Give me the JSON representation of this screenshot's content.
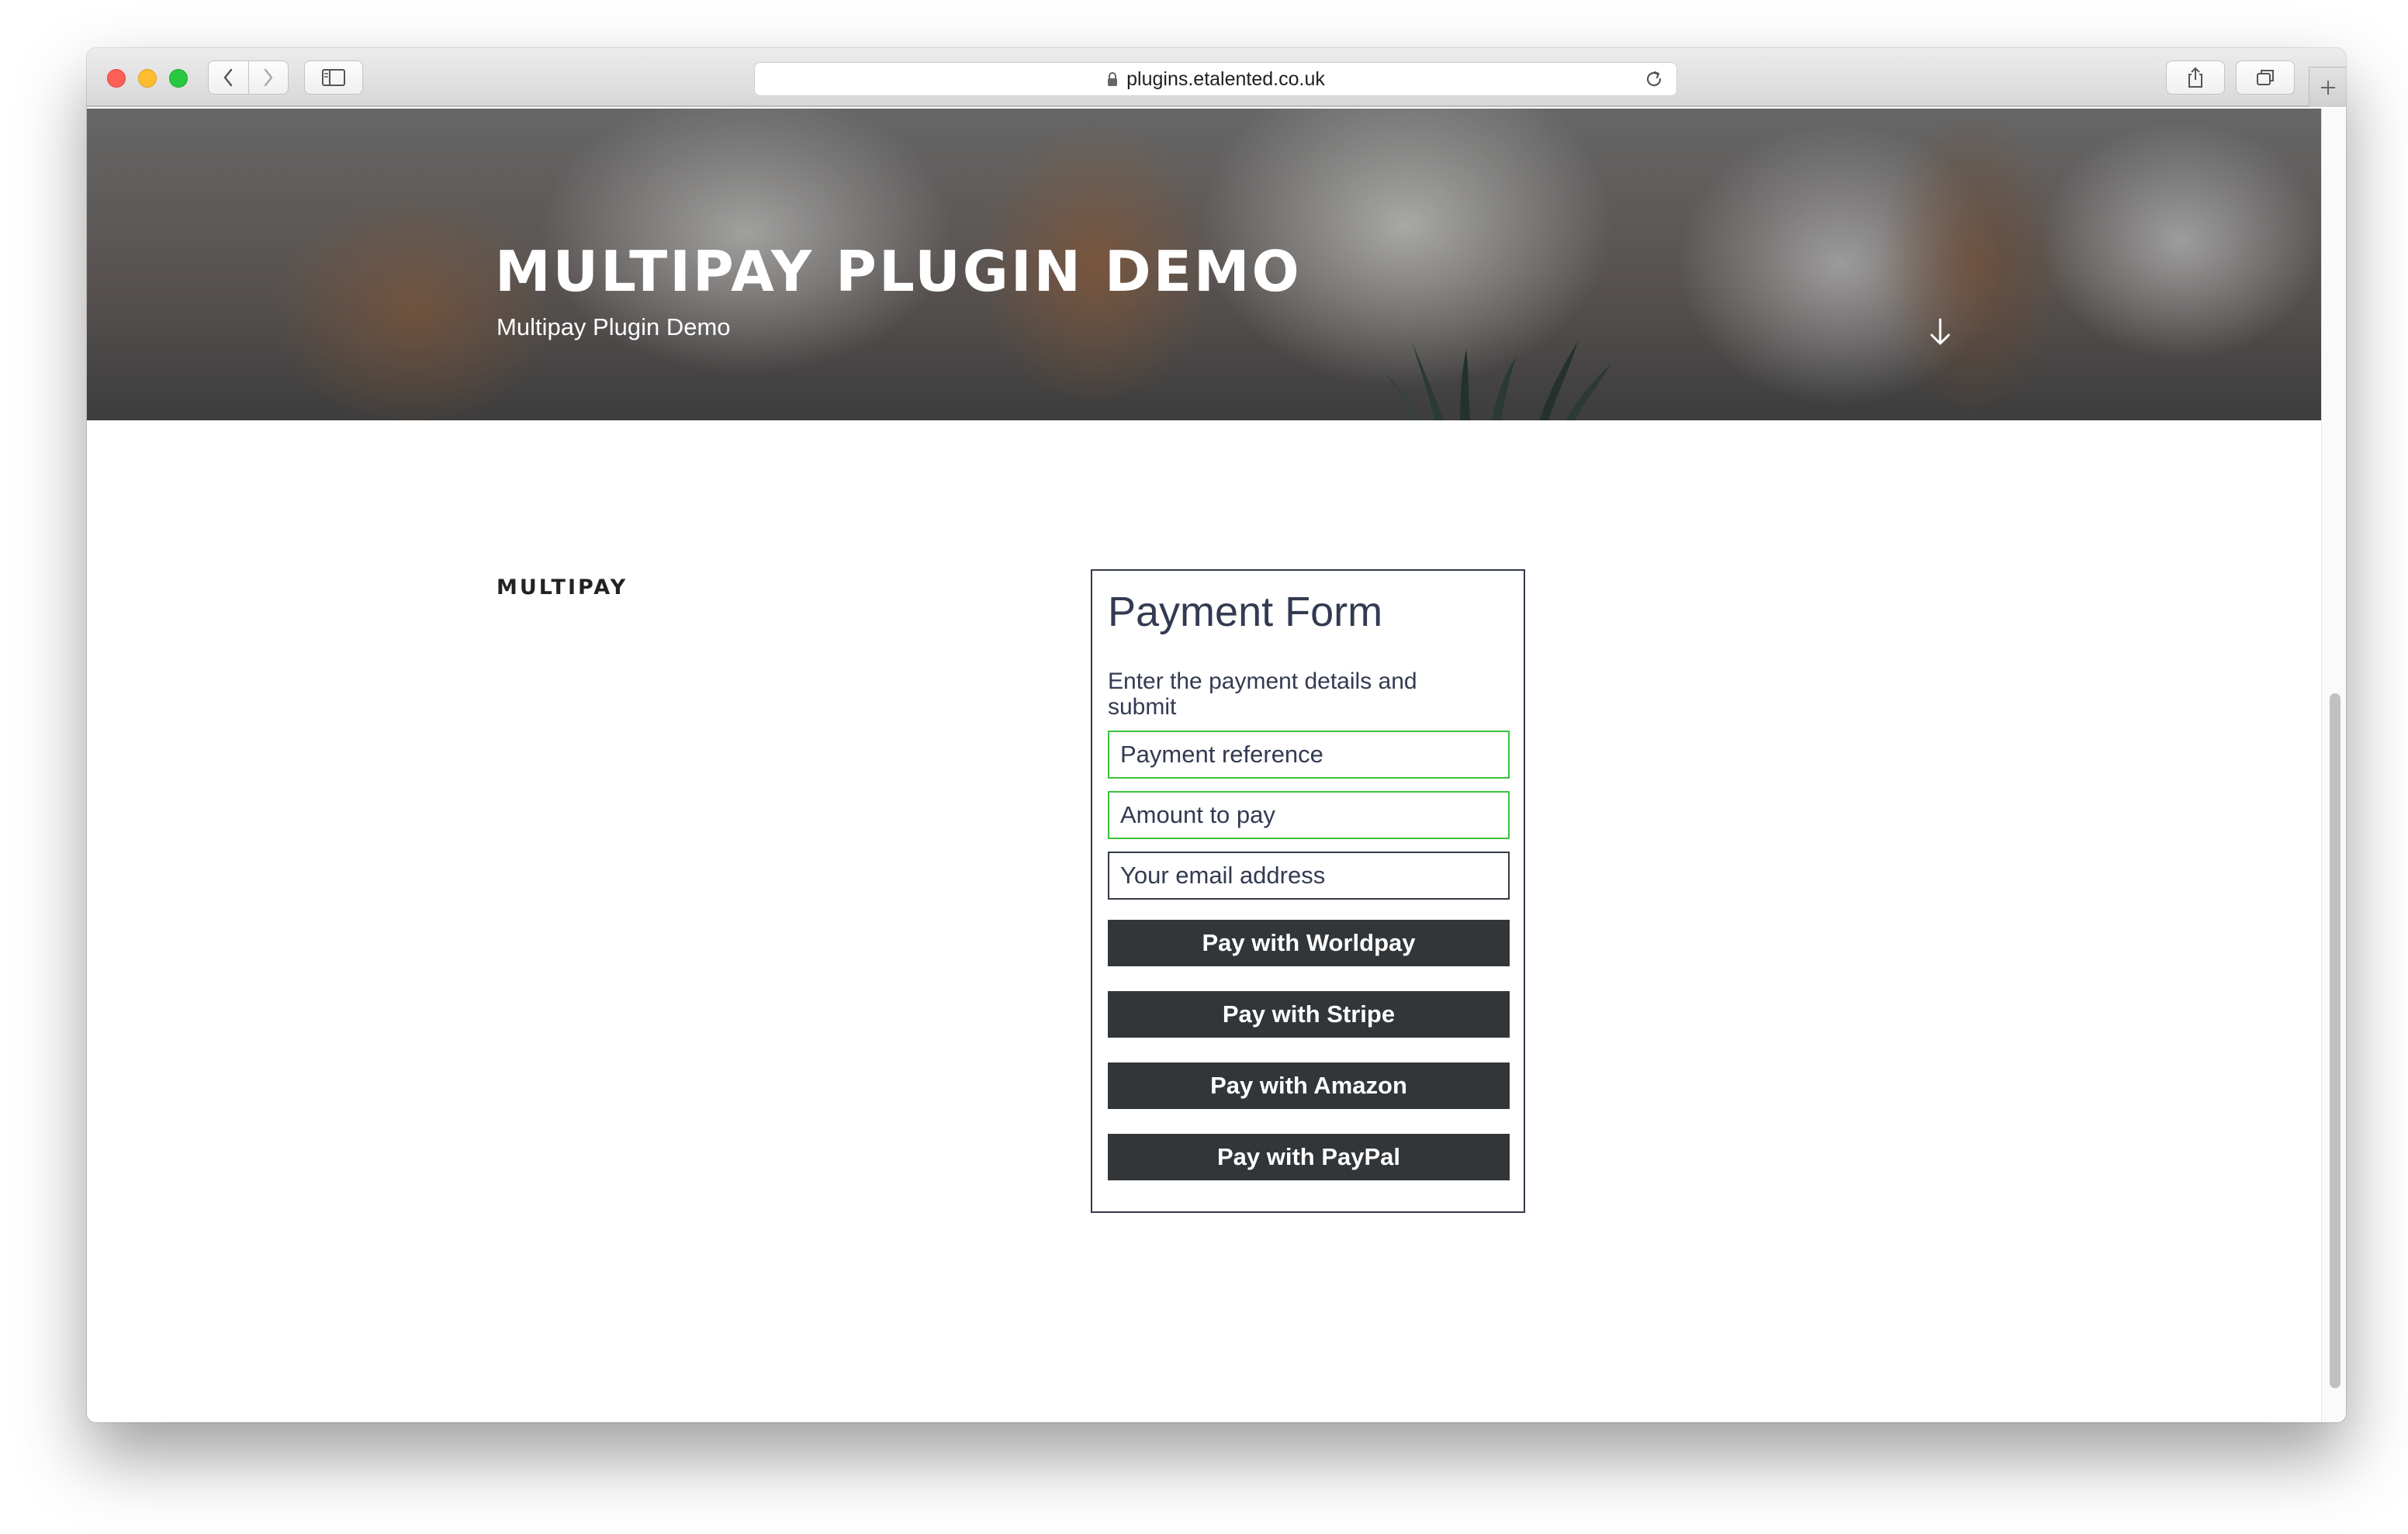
{
  "browser": {
    "url": "plugins.etalented.co.uk"
  },
  "hero": {
    "title": "MULTIPAY PLUGIN DEMO",
    "subtitle": "Multipay Plugin Demo"
  },
  "page": {
    "section_title": "MULTIPAY"
  },
  "payment_form": {
    "heading": "Payment Form",
    "description": "Enter the payment details and submit",
    "fields": {
      "reference_placeholder": "Payment reference",
      "amount_placeholder": "Amount to pay",
      "email_placeholder": "Your email address"
    },
    "buttons": {
      "worldpay": "Pay with Worldpay",
      "stripe": "Pay with Stripe",
      "amazon": "Pay with Amazon",
      "paypal": "Pay with PayPal"
    }
  },
  "colors": {
    "button_bg": "#333639",
    "valid_border": "#3cc23c",
    "form_text": "#333a52"
  },
  "icons": [
    "close-icon",
    "minimize-icon",
    "zoom-icon",
    "back-icon",
    "forward-icon",
    "sidebar-icon",
    "lock-icon",
    "reload-icon",
    "share-icon",
    "tabs-icon",
    "plus-icon",
    "arrow-down-icon"
  ]
}
